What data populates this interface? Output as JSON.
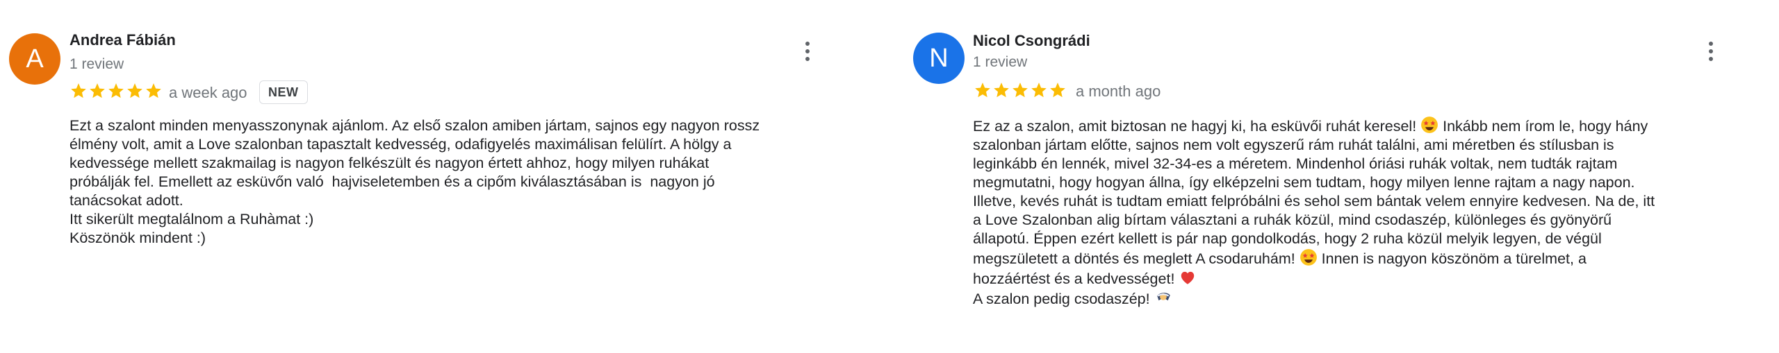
{
  "colors": {
    "avatar_a": "#e8710a",
    "avatar_n": "#1a73e8",
    "star": "#fbbc04",
    "text": "#202124",
    "secondary": "#70757a"
  },
  "reviews": [
    {
      "avatar_letter": "A",
      "name": "Andrea Fábián",
      "review_count": "1 review",
      "rating": 5,
      "date": "a week ago",
      "badge": "NEW",
      "lines": [
        "Ezt a szalont minden menyasszonynak ajánlom. Az első szalon amiben jártam, sajnos egy nagyon rossz",
        "élmény volt, amit a Love szalonban tapasztalt kedvesség, odafigyelés maximálisan felülírt. A hölgy a",
        "kedvessége mellett szakmailag is nagyon felkészült és nagyon értett ahhoz, hogy milyen ruhákat",
        "próbálják fel. Emellett az esküvőn való  hajviseletemben és a cipőm kiválasztásában is  nagyon jó",
        "tanácsokat adott.",
        "Itt sikerült megtalálnom a Ruhàmat :)",
        "Köszönök mindent :)"
      ]
    },
    {
      "avatar_letter": "N",
      "name": "Nicol Csongrádi",
      "review_count": "1 review",
      "rating": 5,
      "date": "a month ago",
      "lines": [
        {
          "a": "Ez az a szalon, amit biztosan ne hagyj ki, ha esküvői ruhát keresel! ",
          "emoji": "star-struck-emoji",
          "b": " Inkább nem írom le, hogy hány"
        },
        "szalonban jártam előtte, sajnos nem volt egyszerű rám ruhát találni, ami méretben és stílusban is",
        "leginkább én lennék, mivel 32-34-es a méretem. Mindenhol óriási ruhák voltak, nem tudták rajtam",
        "megmutatni, hogy hogyan állna, így elképzelni sem tudtam, hogy milyen lenne rajtam a nagy napon.",
        "Illetve, kevés ruhát is tudtam emiatt felpróbálni és sehol sem bántak velem ennyire kedvesen. Na de, itt",
        "a Love Szalonban alig bírtam választani a ruhák közül, mind csodaszép, különleges és gyönyörű",
        "állapotú. Éppen ezért kellett is pár nap gondolkodás, hogy 2 ruha közül melyik legyen, de végül",
        {
          "a": "megszületett a döntés és meglett A csodaruhám! ",
          "emoji": "star-struck-emoji",
          "b": " Innen is nagyon köszönöm a türelmet, a"
        },
        {
          "a": "hozzáértést és a kedvességet! ",
          "emoji": "red-heart-emoji",
          "b": ""
        },
        {
          "a": "A szalon pedig csodaszép! ",
          "emoji": "bridal-veil-emoji",
          "b": ""
        }
      ]
    }
  ]
}
